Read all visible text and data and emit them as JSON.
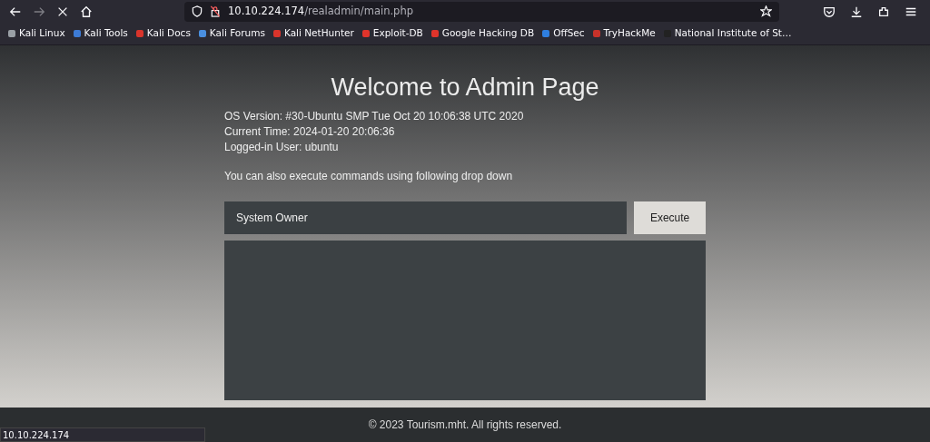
{
  "browser": {
    "url_host": "10.10.224.174",
    "url_path": "/realadmin/main.php",
    "bookmarks": [
      {
        "label": "Kali Linux",
        "color": "#9aa0a6"
      },
      {
        "label": "Kali Tools",
        "color": "#3d7bd6"
      },
      {
        "label": "Kali Docs",
        "color": "#d9342b"
      },
      {
        "label": "Kali Forums",
        "color": "#4a8fe0"
      },
      {
        "label": "Kali NetHunter",
        "color": "#d9342b"
      },
      {
        "label": "Exploit-DB",
        "color": "#e0342b"
      },
      {
        "label": "Google Hacking DB",
        "color": "#e0342b"
      },
      {
        "label": "OffSec",
        "color": "#2f7fe0"
      },
      {
        "label": "TryHackMe",
        "color": "#c8322a"
      },
      {
        "label": "National Institute of St…",
        "color": "#222222"
      }
    ],
    "status_url": "10.10.224.174"
  },
  "page": {
    "title": "Welcome to Admin Page",
    "info": [
      "OS Version: #30-Ubuntu SMP Tue Oct 20 10:06:38 UTC 2020",
      "Current Time: 2024-01-20 20:06:36",
      "Logged-in User: ubuntu"
    ],
    "note": "You can also execute commands using following drop down",
    "command": {
      "value": "System Owner"
    },
    "button": "Execute",
    "footer": "© 2023 Tourism.mht. All rights reserved."
  }
}
